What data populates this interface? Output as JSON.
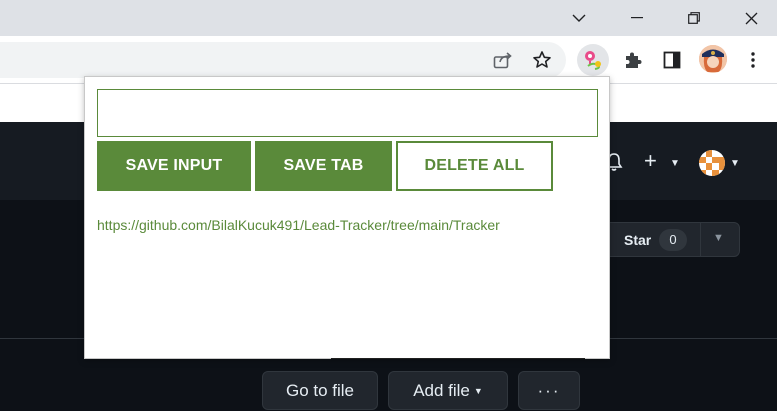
{
  "browser": {
    "window_controls": [
      "chevron-down",
      "minimize",
      "restore",
      "close"
    ],
    "toolbar_icons": [
      "share-icon",
      "bookmark-star-icon",
      "lead-tracker-extension-icon",
      "extensions-puzzle-icon",
      "side-panel-icon",
      "profile-avatar",
      "menu-dots-icon"
    ]
  },
  "github": {
    "star": {
      "label": "Star",
      "count": "0"
    },
    "buttons": {
      "go_to_file": "Go to file",
      "add_file": "Add file",
      "more": "···"
    }
  },
  "popup": {
    "input": {
      "value": "",
      "placeholder": ""
    },
    "buttons": {
      "save_input": "SAVE INPUT",
      "save_tab": "SAVE TAB",
      "delete_all": "DELETE ALL"
    },
    "leads": [
      "https://github.com/BilalKucuk491/Lead-Tracker/tree/main/Tracker"
    ]
  },
  "colors": {
    "accent": "#5a8a3a",
    "titlebar": "#dee1e6",
    "github_bg": "#0d1117",
    "github_header": "#161b22"
  }
}
